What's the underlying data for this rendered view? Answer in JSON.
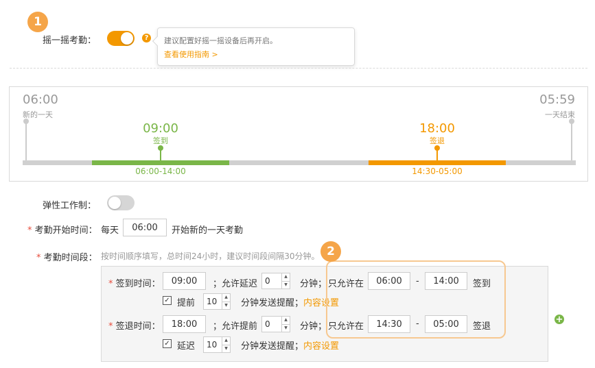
{
  "steps": {
    "one": "1",
    "two": "2"
  },
  "shake": {
    "label": "摇一摇考勤：",
    "enabled": true,
    "help_icon": "question-icon",
    "tooltip_text": "建议配置好摇一摇设备后再开启。",
    "tooltip_link": "查看使用指南 >"
  },
  "timeline": {
    "start_time": "06:00",
    "start_label": "新的一天",
    "end_time": "05:59",
    "end_label": "一天结束",
    "checkin_time": "09:00",
    "checkin_label": "签到",
    "checkin_range": "06:00-14:00",
    "checkout_time": "18:00",
    "checkout_label": "签退",
    "checkout_range": "14:30-05:00"
  },
  "flex": {
    "label": "弹性工作制：",
    "enabled": false
  },
  "start": {
    "required_mark": "*",
    "label": "考勤开始时间：",
    "prefix": "每天",
    "value": "06:00",
    "suffix": "开始新的一天考勤"
  },
  "period": {
    "required_mark": "*",
    "label": "考勤时间段：",
    "hint": "按时间顺序填写，总时间24小时，建议时间段间隔30分钟。"
  },
  "checkin": {
    "required_mark": "*",
    "label": "签到时间：",
    "time": "09:00",
    "delay_label": "；允许延迟",
    "delay": "0",
    "minute_label": "分钟；",
    "allow_label": "只允许在",
    "from": "06:00",
    "dash": "-",
    "to": "14:00",
    "action": "签到",
    "remind_checked": true,
    "remind_label": "提前",
    "remind_value": "10",
    "remind_suffix": "分钟发送提醒；",
    "content_link": "内容设置"
  },
  "checkout": {
    "required_mark": "*",
    "label": "签退时间：",
    "time": "18:00",
    "early_label": "；允许提前",
    "early": "0",
    "minute_label": "分钟；",
    "allow_label": "只允许在",
    "from": "14:30",
    "dash": "-",
    "to": "05:00",
    "action": "签退",
    "remind_checked": true,
    "remind_label": "延迟",
    "remind_value": "10",
    "remind_suffix": "分钟发送提醒；",
    "content_link": "内容设置"
  },
  "colors": {
    "accent": "#f39800",
    "green": "#7ab648",
    "badge": "#f5a549",
    "highlight": "#f7c890"
  }
}
